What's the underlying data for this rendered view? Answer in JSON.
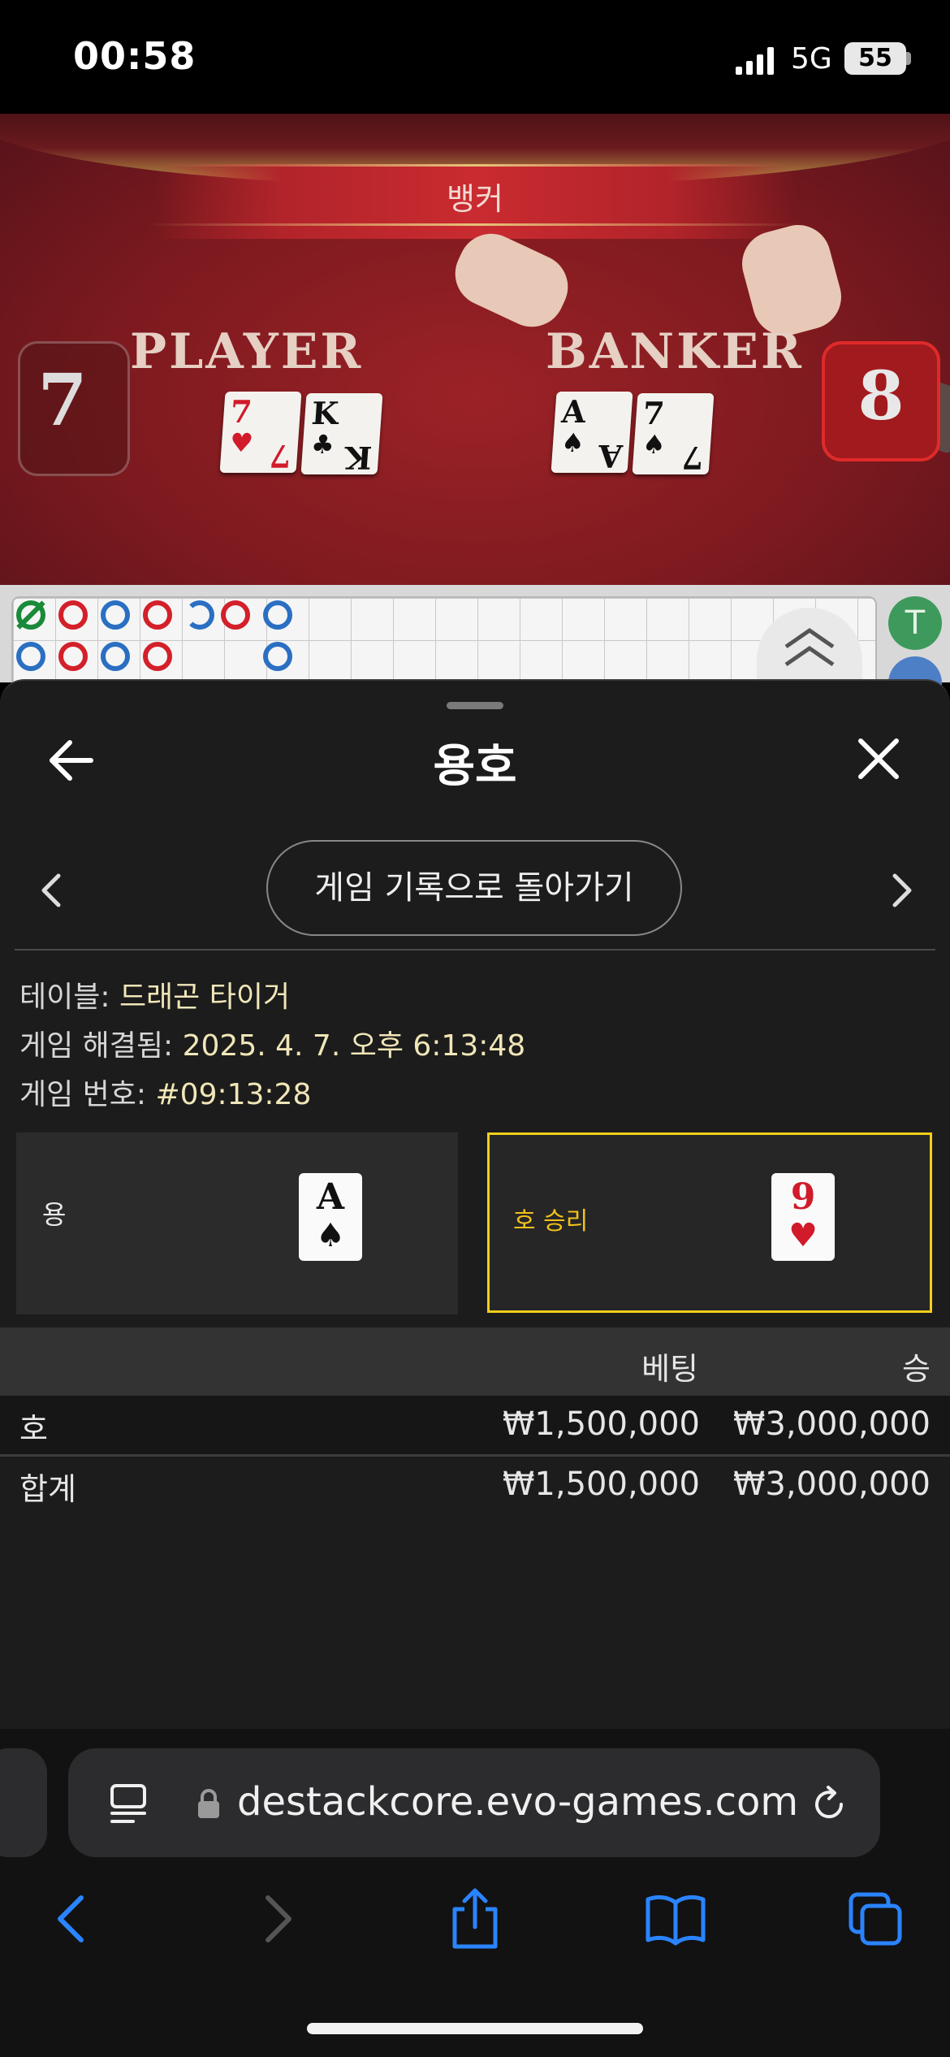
{
  "status_bar": {
    "time": "00:58",
    "network": "5G",
    "battery": "55"
  },
  "video": {
    "banner": "뱅커",
    "player_label": "PLAYER",
    "banker_label": "BANKER",
    "player_score": "7",
    "banker_score": "8",
    "player_cards": [
      {
        "rank": "7",
        "suit": "♥",
        "color": "#d11a2a"
      },
      {
        "rank": "K",
        "suit": "♣",
        "color": "#111111"
      }
    ],
    "banker_cards": [
      {
        "rank": "A",
        "suit": "♠",
        "color": "#111111"
      },
      {
        "rank": "7",
        "suit": "♠",
        "color": "#111111"
      }
    ]
  },
  "roadmap": {
    "tie_label": "T"
  },
  "sheet": {
    "title": "용호",
    "history_button": "게임 기록으로 돌아가기",
    "table_label": "테이블: ",
    "table_value": "드래곤 타이거",
    "resolved_label": "게임 해결됨: ",
    "resolved_value": "2025. 4. 7. 오후 6:13:48",
    "game_no_label": "게임 번호: ",
    "game_no_value": "#09:13:28",
    "dragon": {
      "label": "용",
      "card_rank": "A",
      "card_suit": "♠"
    },
    "tiger": {
      "label": "호 승리",
      "card_rank": "9",
      "card_suit": "♥"
    },
    "table_headers": {
      "bet": "베팅",
      "win": "승"
    },
    "rows": [
      {
        "name": "호",
        "bet": "₩1,500,000",
        "win": "₩3,000,000"
      }
    ],
    "total": {
      "name": "합계",
      "bet": "₩1,500,000",
      "win": "₩3,000,000"
    }
  },
  "browser": {
    "url": "destackcore.evo-games.com"
  },
  "colors": {
    "highlight": "#f2cf1a",
    "accent_blue": "#2a84ff"
  }
}
